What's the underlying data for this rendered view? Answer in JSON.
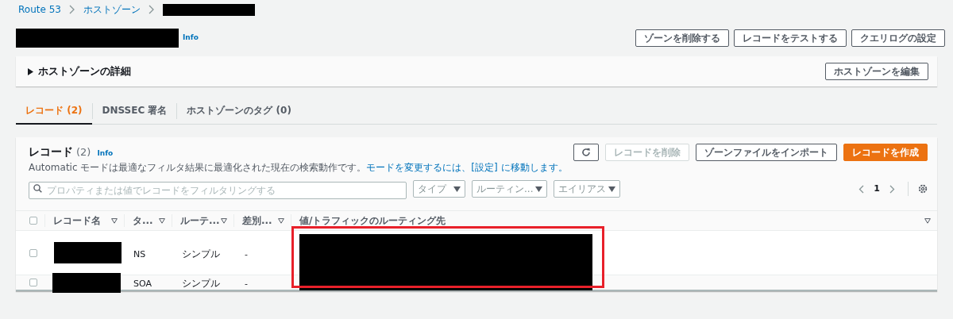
{
  "breadcrumb": [
    "Route 53",
    "ホストゾーン"
  ],
  "header": {
    "info": "Info",
    "buttons": [
      "ゾーンを削除する",
      "レコードをテストする",
      "クエリログの設定"
    ]
  },
  "details": {
    "title": "ホストゾーンの詳細",
    "expanded": false,
    "button": "ホストゾーンを編集"
  },
  "tabs": [
    {
      "label": "レコード (2)",
      "selected": true
    },
    {
      "label": "DNSSEC 署名",
      "selected": false
    },
    {
      "label": "ホストゾーンのタグ (0)",
      "selected": false
    }
  ],
  "records": {
    "title": "レコード",
    "count": "(2)",
    "info": "Info",
    "description": "Automatic モードは最適なフィルタ結果に最適化された現在の検索動作です。",
    "link": "モードを変更するには、[設定] に移動します。",
    "actions": [
      {
        "kind": "refresh"
      },
      {
        "kind": "disabled",
        "label": "レコードを削除"
      },
      {
        "kind": "normal",
        "label": "ゾーンファイルをインポート"
      },
      {
        "kind": "primary",
        "label": "レコードを作成"
      }
    ],
    "search": {
      "placeholder": "プロパティまたは値でレコードをフィルタリングする"
    },
    "filters": [
      "タイプ",
      "ルーティン...",
      "エイリアス"
    ],
    "page": "1",
    "select_all": {
      "checked": false
    },
    "columns": [
      "レコード名",
      "タ...",
      "ルーテ...",
      "差別...",
      "値/トラフィックのルーティング先"
    ],
    "rows": [
      {
        "checked": false,
        "type": "NS",
        "routing": "シンプル",
        "diff": "-"
      },
      {
        "checked": false,
        "type": "SOA",
        "routing": "シンプル",
        "diff": "-"
      }
    ]
  }
}
